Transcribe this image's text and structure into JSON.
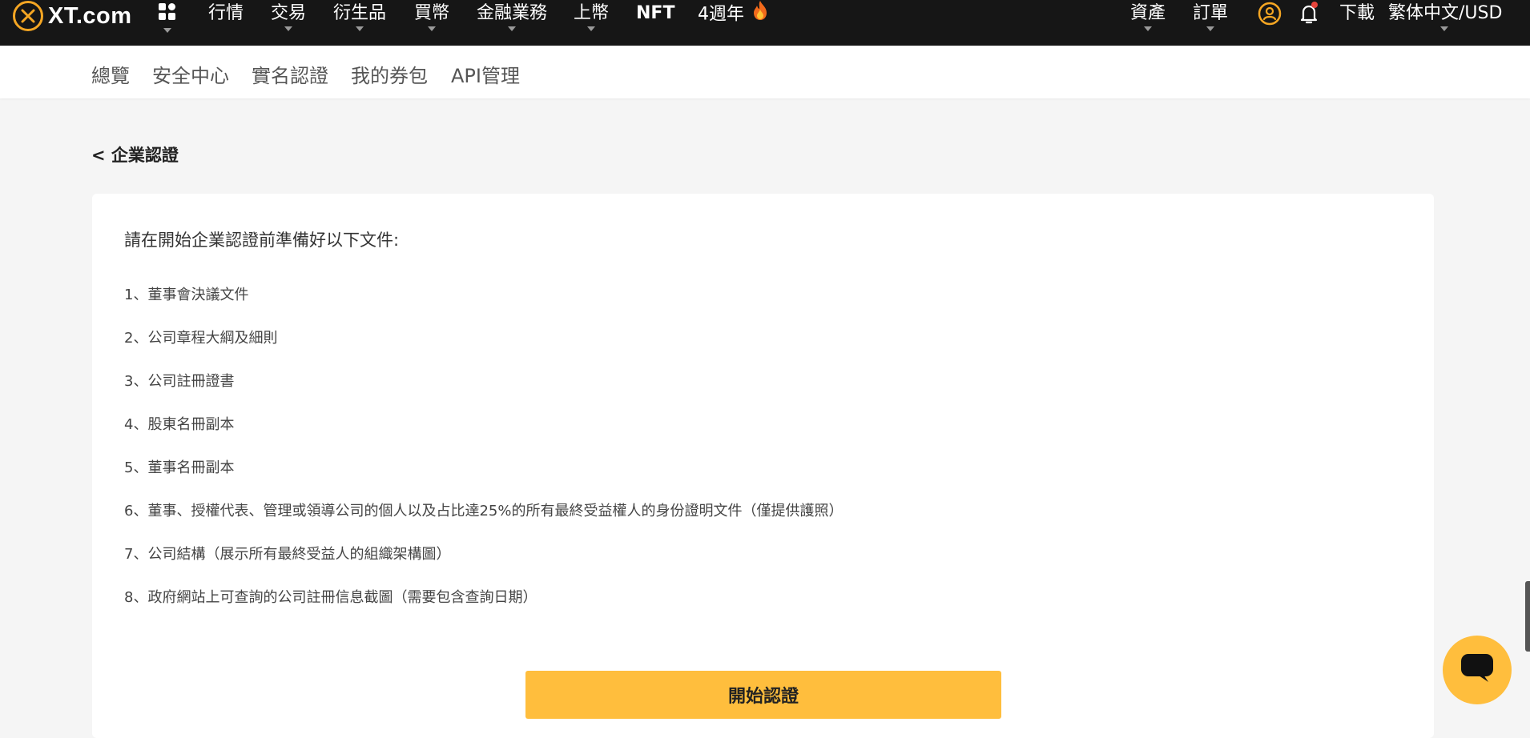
{
  "header": {
    "logo_text": "XT.com",
    "nav": [
      "行情",
      "交易",
      "衍生品",
      "買幣",
      "金融業務",
      "上幣",
      "NFT",
      "4週年"
    ],
    "right": {
      "assets": "資產",
      "orders": "訂單",
      "download": "下載",
      "language": "繁体中文/USD"
    },
    "colors": {
      "brand": "#f5a623",
      "bar": "#161616",
      "notification_dot": "#e8453c"
    }
  },
  "subnav": {
    "tabs": [
      "總覽",
      "安全中心",
      "實名認證",
      "我的券包",
      "API管理"
    ]
  },
  "page": {
    "back_label": "< 企業認證",
    "intro": "請在開始企業認證前準備好以下文件:",
    "documents": [
      "1、董事會決議文件",
      "2、公司章程大綱及細則",
      "3、公司註冊證書",
      "4、股東名冊副本",
      "5、董事名冊副本",
      "6、董事、授權代表、管理或領導公司的個人以及占比達25%的所有最終受益權人的身份證明文件（僅提供護照）",
      "7、公司結構（展示所有最終受益人的組織架構圖）",
      "8、政府網站上可查詢的公司註冊信息截圖（需要包含查詢日期）"
    ],
    "start_button": "開始認證",
    "button_color": "#ffbe3d"
  }
}
